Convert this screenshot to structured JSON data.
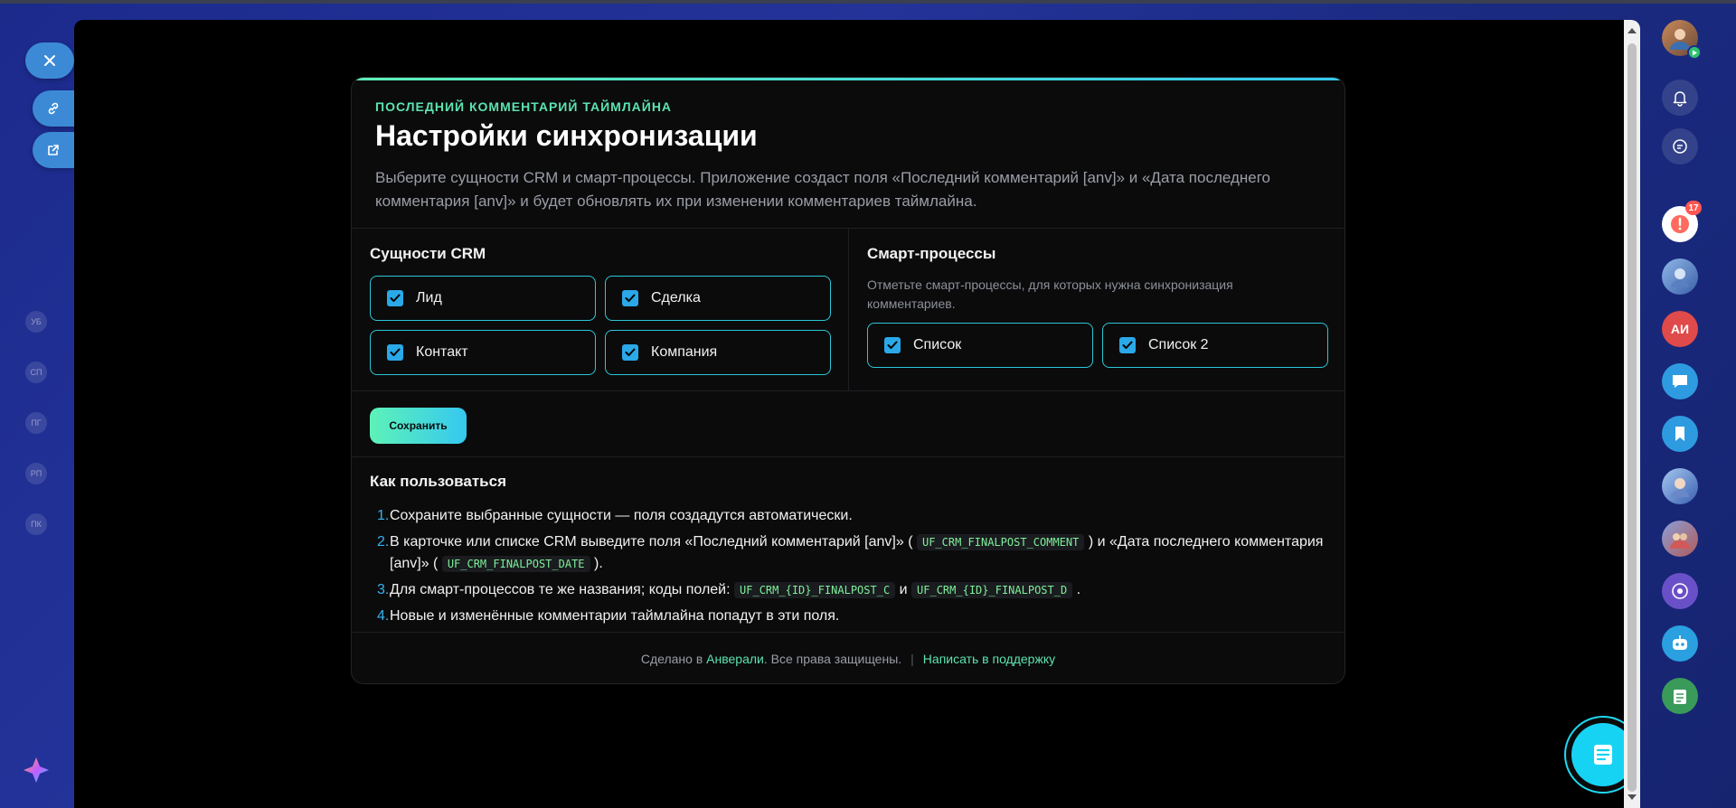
{
  "background": {
    "left_nav_badges": [
      "УБ",
      "СП",
      "ПГ",
      "РП",
      "ПК"
    ]
  },
  "slider_actions": {
    "close_icon": "close-icon",
    "copy_link_icon": "link-icon",
    "open_new_window_icon": "external-link-icon"
  },
  "right_panel": {
    "notifications_badge": "17",
    "initials_avatar": "АИ"
  },
  "app": {
    "eyebrow": "ПОСЛЕДНИЙ КОММЕНТАРИЙ ТАЙМЛАЙНА",
    "title": "Настройки синхронизации",
    "description": "Выберите сущности CRM и смарт-процессы. Приложение создаст поля «Последний комментарий [anv]» и «Дата последнего комментария [anv]» и будет обновлять их при изменении комментариев таймлайна.",
    "crm_section": {
      "title": "Сущности CRM",
      "items": [
        {
          "label": "Лид",
          "checked": true
        },
        {
          "label": "Сделка",
          "checked": true
        },
        {
          "label": "Контакт",
          "checked": true
        },
        {
          "label": "Компания",
          "checked": true
        }
      ]
    },
    "smart_section": {
      "title": "Смарт-процессы",
      "hint": "Отметьте смарт-процессы, для которых нужна синхронизация комментариев.",
      "items": [
        {
          "label": "Список",
          "checked": true
        },
        {
          "label": "Список 2",
          "checked": true
        }
      ]
    },
    "save_label": "Сохранить",
    "howto": {
      "title": "Как пользоваться",
      "steps": {
        "s1": {
          "num": "1.",
          "text": "Сохраните выбранные сущности — поля создадутся автоматически."
        },
        "s2": {
          "num": "2.",
          "text_a": "В карточке или списке CRM выведите поля «Последний комментарий [anv]» (",
          "code_a": "UF_CRM_FINALPOST_COMMENT",
          "text_b": ") и «Дата последнего комментария [anv]» (",
          "code_b": "UF_CRM_FINALPOST_DATE",
          "text_c": ")."
        },
        "s3": {
          "num": "3.",
          "text_a": "Для смарт-процессов те же названия; коды полей:",
          "code_a": "UF_CRM_{ID}_FINALPOST_C",
          "text_b": "и",
          "code_b": "UF_CRM_{ID}_FINALPOST_D",
          "text_c": "."
        },
        "s4": {
          "num": "4.",
          "text": "Новые и изменённые комментарии таймлайна попадут в эти поля."
        }
      }
    },
    "footer": {
      "made_prefix": "Сделано в",
      "brand": "Анверали",
      "rights": ". Все права защищены.",
      "separator": "|",
      "support": "Написать в поддержку"
    }
  },
  "colors": {
    "accent_start": "#5ef2b8",
    "accent_end": "#35c8f0",
    "checkbox": "#2aa8e8",
    "background": "#000000"
  }
}
